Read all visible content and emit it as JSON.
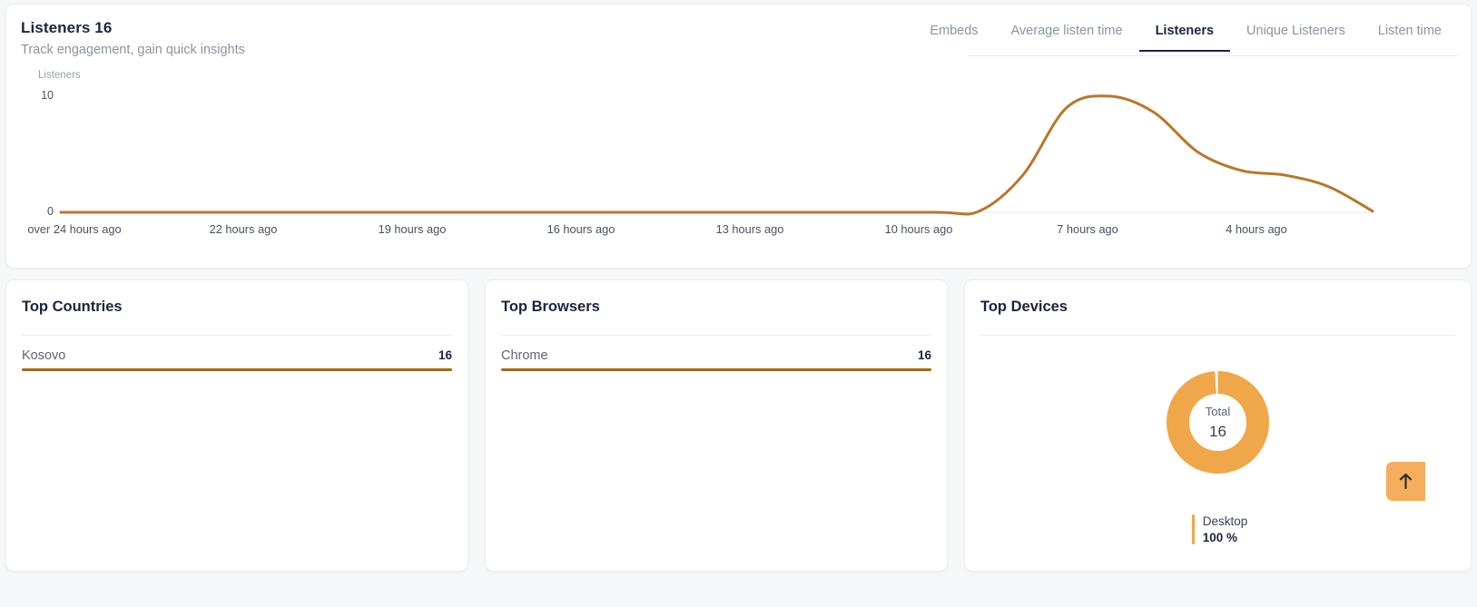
{
  "header": {
    "title": "Listeners 16",
    "subtitle": "Track engagement, gain quick insights"
  },
  "tabs": [
    {
      "label": "Embeds",
      "active": false
    },
    {
      "label": "Average listen time",
      "active": false
    },
    {
      "label": "Listeners",
      "active": true
    },
    {
      "label": "Unique Listeners",
      "active": false
    },
    {
      "label": "Listen time",
      "active": false
    }
  ],
  "chart_data": {
    "type": "line",
    "title": "Listeners",
    "xlabel": "",
    "ylabel": "Listeners",
    "ylim": [
      0,
      10
    ],
    "yticks": [
      "0",
      "10"
    ],
    "grid": false,
    "legend": "none",
    "line_color": "#b8772a",
    "categories": [
      "over 24 hours ago",
      "22 hours ago",
      "19 hours ago",
      "16 hours ago",
      "13 hours ago",
      "10 hours ago",
      "7 hours ago",
      "4 hours ago"
    ],
    "x": [
      0,
      2,
      5,
      8,
      11,
      14,
      17,
      20,
      21,
      22,
      23,
      24,
      25,
      26,
      27,
      28,
      29,
      30
    ],
    "values": [
      0,
      0,
      0,
      0,
      0,
      0,
      0,
      0,
      0.1,
      3.2,
      9.0,
      10.0,
      8.6,
      5.2,
      3.6,
      3.2,
      2.2,
      0.1
    ]
  },
  "cards": {
    "countries": {
      "title": "Top Countries",
      "rows": [
        {
          "name": "Kosovo",
          "value": "16",
          "percent": 100
        }
      ]
    },
    "browsers": {
      "title": "Top Browsers",
      "rows": [
        {
          "name": "Chrome",
          "value": "16",
          "percent": 100
        }
      ]
    },
    "devices": {
      "title": "Top Devices",
      "chart_data": {
        "type": "pie",
        "title": "Top Devices",
        "categories": [
          "Desktop"
        ],
        "values": [
          16
        ],
        "percentages": [
          100
        ],
        "colors": [
          "#efa749"
        ]
      },
      "total_label": "Total",
      "total_value": "16",
      "legend": [
        {
          "name": "Desktop",
          "percent": "100 %",
          "color": "#efa749"
        }
      ]
    }
  },
  "scroll_top": {
    "icon": "arrow-up-icon",
    "color": "#f4ad5c"
  }
}
